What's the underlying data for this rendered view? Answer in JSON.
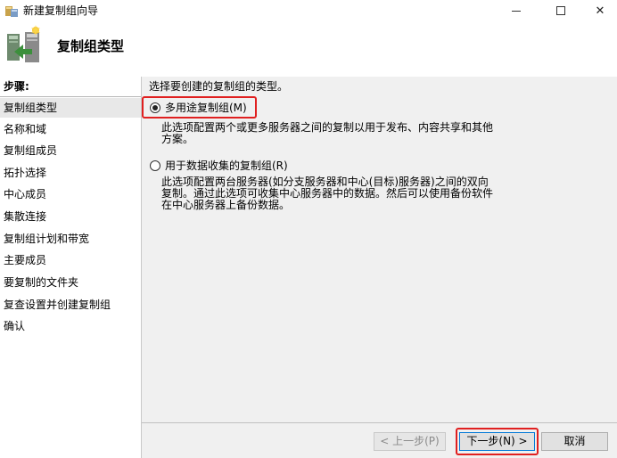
{
  "window": {
    "title": "新建复制组向导",
    "minimize_icon": "minimize-icon",
    "maximize_icon": "maximize-icon",
    "close_label": "✕"
  },
  "header": {
    "title": "复制组类型"
  },
  "steps": {
    "heading": "步骤:",
    "items": [
      {
        "label": "复制组类型"
      },
      {
        "label": "名称和域"
      },
      {
        "label": "复制组成员"
      },
      {
        "label": "拓扑选择"
      },
      {
        "label": "中心成员"
      },
      {
        "label": "集散连接"
      },
      {
        "label": "复制组计划和带宽"
      },
      {
        "label": "主要成员"
      },
      {
        "label": "要复制的文件夹"
      },
      {
        "label": "复查设置并创建复制组"
      },
      {
        "label": "确认"
      }
    ],
    "current_index": 0
  },
  "content": {
    "intro": "选择要创建的复制组的类型。",
    "options": [
      {
        "label": "多用途复制组(M)",
        "checked": true,
        "description": "此选项配置两个或更多服务器之间的复制以用于发布、内容共享和其他\n方案。"
      },
      {
        "label": "用于数据收集的复制组(R)",
        "checked": false,
        "description": "此选项配置两台服务器(如分支服务器和中心(目标)服务器)之间的双向\n复制。通过此选项可收集中心服务器中的数据。然后可以使用备份软件\n在中心服务器上备份数据。"
      }
    ]
  },
  "footer": {
    "prev_label": "< 上一步(P)",
    "next_label": "下一步(N) >",
    "cancel_label": "取消"
  },
  "colors": {
    "highlight": "#e02020",
    "content_bg": "#f0f0f0",
    "selected_step_bg": "#e8e8e8"
  }
}
